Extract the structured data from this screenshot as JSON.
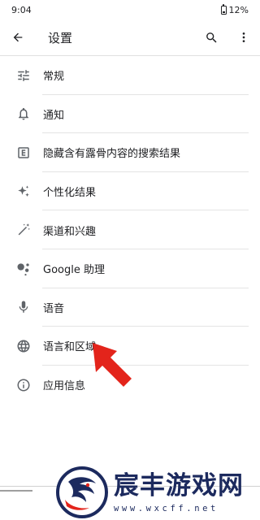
{
  "status_bar": {
    "time": "9:04",
    "battery": "12%"
  },
  "app_bar": {
    "title": "设置",
    "icons": [
      "back-arrow-icon",
      "search-icon",
      "more-vert-icon"
    ]
  },
  "settings_items": [
    {
      "label": "常规",
      "icon": "tune-icon"
    },
    {
      "label": "通知",
      "icon": "bell-icon"
    },
    {
      "label": "隐藏含有露骨内容的搜索结果",
      "icon": "explicit-icon"
    },
    {
      "label": "个性化结果",
      "icon": "sparkle-icon"
    },
    {
      "label": "渠道和兴趣",
      "icon": "magic-wand-icon"
    },
    {
      "label": "Google 助理",
      "icon": "assistant-icon"
    },
    {
      "label": "语音",
      "icon": "mic-icon"
    },
    {
      "label": "语言和区域",
      "icon": "globe-icon"
    },
    {
      "label": "应用信息",
      "icon": "info-icon"
    }
  ],
  "watermark": {
    "title": "宸丰游戏网",
    "url": "www.wxcff.net"
  },
  "colors": {
    "text": "#202124",
    "divider": "#e4e4e4",
    "arrow": "#e3241b",
    "watermark": "#1c2a5e"
  }
}
